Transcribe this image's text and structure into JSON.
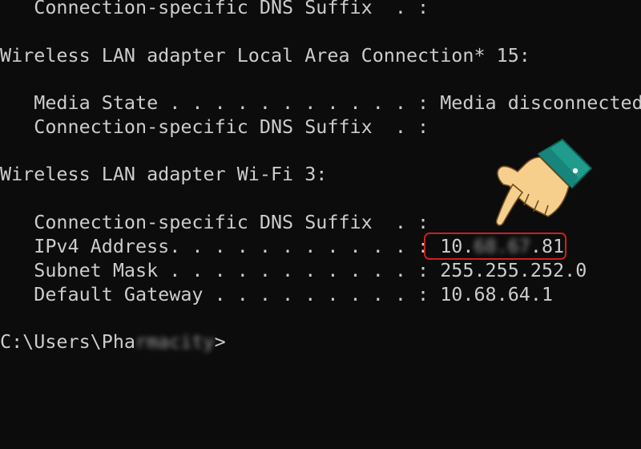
{
  "terminal": {
    "lines": [
      {
        "text": "   Connection-specific DNS Suffix  . :"
      },
      {
        "text": ""
      },
      {
        "text": "Wireless LAN adapter Local Area Connection* 15:"
      },
      {
        "text": ""
      },
      {
        "text": "   Media State . . . . . . . . . . . : Media disconnected"
      },
      {
        "text": "   Connection-specific DNS Suffix  . :"
      },
      {
        "text": ""
      },
      {
        "text": "Wireless LAN adapter Wi-Fi 3:"
      },
      {
        "text": ""
      },
      {
        "text": "   Connection-specific DNS Suffix  . :"
      }
    ],
    "ipv4": {
      "label": "   IPv4 Address. . . . . . . . . . . : ",
      "prefix": "10.",
      "blurred": "68.67",
      "suffix": ".81"
    },
    "subnet": {
      "text": "   Subnet Mask . . . . . . . . . . . : 255.255.252.0"
    },
    "gateway": {
      "text": "   Default Gateway . . . . . . . . . : 10.68.64.1"
    },
    "prompt": {
      "prefix": "C:\\Users\\Pha",
      "blurred": "rmacity",
      "suffix": ">"
    }
  },
  "annotations": {
    "highlight_color": "#cc2020",
    "pointer_icon": "pointing-hand-icon",
    "sleeve_color": "#1f9c8c",
    "skin_color": "#f7cf8d"
  }
}
